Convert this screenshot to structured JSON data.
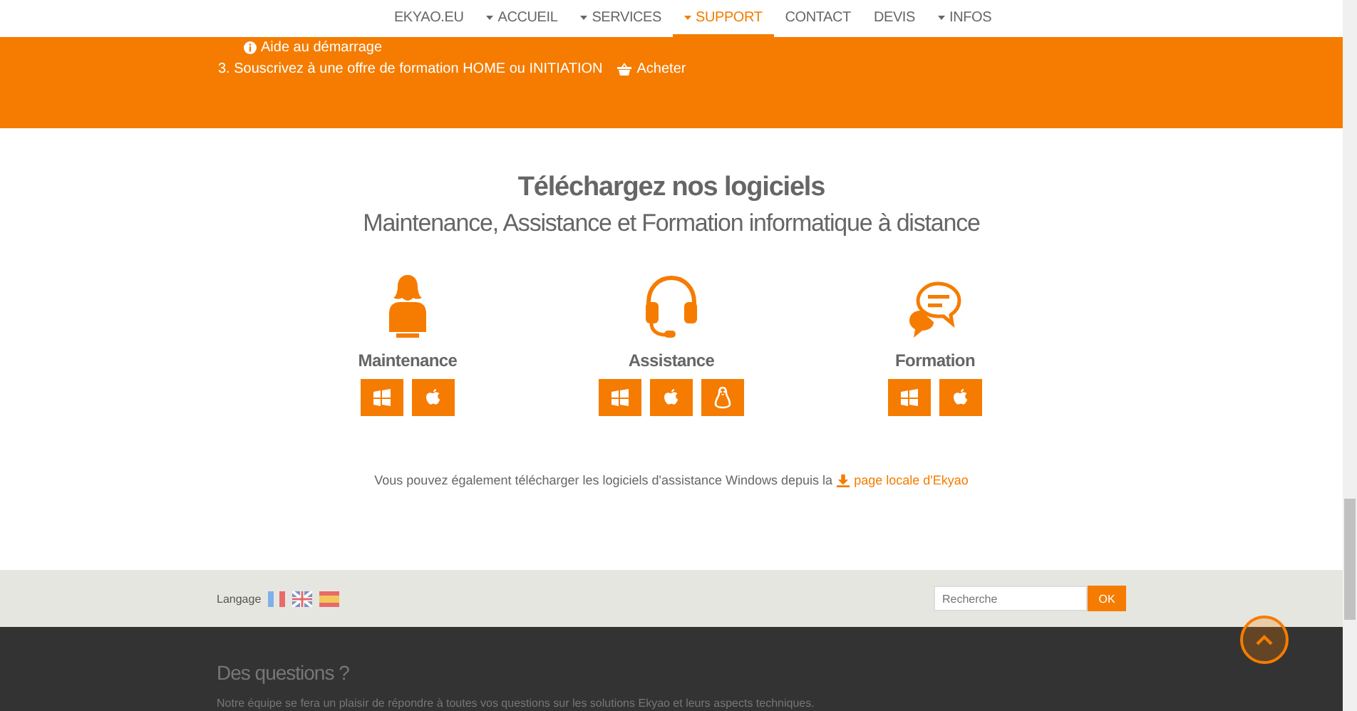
{
  "nav": {
    "items": [
      {
        "label": "EKYAO.EU",
        "caret": false,
        "selected": false
      },
      {
        "label": "ACCUEIL",
        "caret": true,
        "selected": false
      },
      {
        "label": "SERVICES",
        "caret": true,
        "selected": false
      },
      {
        "label": "SUPPORT",
        "caret": true,
        "selected": true
      },
      {
        "label": "CONTACT",
        "caret": false,
        "selected": false
      },
      {
        "label": "DEVIS",
        "caret": false,
        "selected": false
      },
      {
        "label": "INFOS",
        "caret": true,
        "selected": false
      }
    ]
  },
  "banner": {
    "help_link": "Aide au démarrage",
    "step": "3. Souscrivez à une offre de formation HOME ou INITIATION",
    "buy_link": "Acheter"
  },
  "downloads": {
    "title": "Téléchargez nos logiciels",
    "subtitle": "Maintenance, Assistance et Formation informatique à distance",
    "products": [
      {
        "kind": "maintenance",
        "name": "Maintenance",
        "platforms": [
          {
            "kind": "windows"
          },
          {
            "kind": "apple"
          }
        ]
      },
      {
        "kind": "assistance",
        "name": "Assistance",
        "platforms": [
          {
            "kind": "windows"
          },
          {
            "kind": "apple"
          },
          {
            "kind": "linux"
          }
        ]
      },
      {
        "kind": "formation",
        "name": "Formation",
        "platforms": [
          {
            "kind": "windows"
          },
          {
            "kind": "apple"
          }
        ]
      }
    ],
    "note": "Vous pouvez également télécharger les logiciels d'assistance Windows depuis la",
    "note_link": "page locale d'Ekyao"
  },
  "footer_bar": {
    "language_label": "Langage",
    "flags": [
      {
        "kind": "fr"
      },
      {
        "kind": "en"
      },
      {
        "kind": "es"
      }
    ],
    "search": {
      "placeholder": "Recherche"
    },
    "search_button": "OK"
  },
  "footer": {
    "title": "Des questions ?",
    "text": "Notre équipe se fera un plaisir de répondre à toutes vos questions sur les solutions Ekyao et leurs aspects techniques."
  }
}
